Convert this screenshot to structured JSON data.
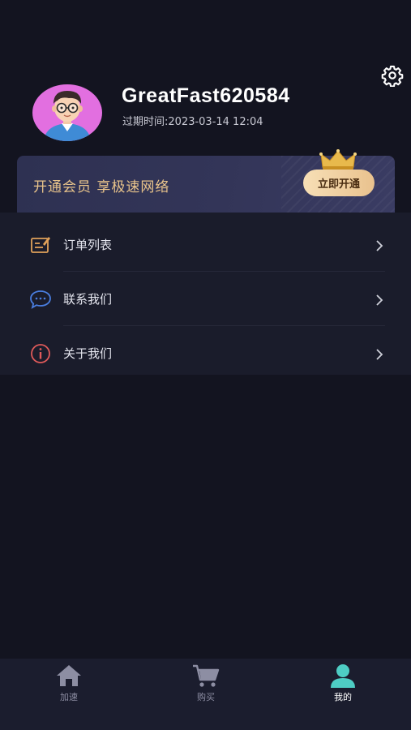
{
  "profile": {
    "username": "GreatFast620584",
    "expiry": "过期时间:2023-03-14 12:04"
  },
  "vip": {
    "text": "开通会员 享极速网络",
    "button_label": "立即开通"
  },
  "menu": {
    "items": [
      {
        "label": "订单列表",
        "icon": "order-list-icon"
      },
      {
        "label": "联系我们",
        "icon": "chat-bubble-icon"
      },
      {
        "label": "关于我们",
        "icon": "info-icon"
      }
    ]
  },
  "tabbar": {
    "tabs": [
      {
        "label": "加速",
        "icon": "home-icon"
      },
      {
        "label": "购买",
        "icon": "cart-icon"
      },
      {
        "label": "我的",
        "icon": "user-icon",
        "active": true
      }
    ]
  },
  "colors": {
    "background": "#131420",
    "menu_background": "#1a1c2b",
    "accent_gold": "#e9c48b",
    "active_tab": "#4ecdc4"
  }
}
